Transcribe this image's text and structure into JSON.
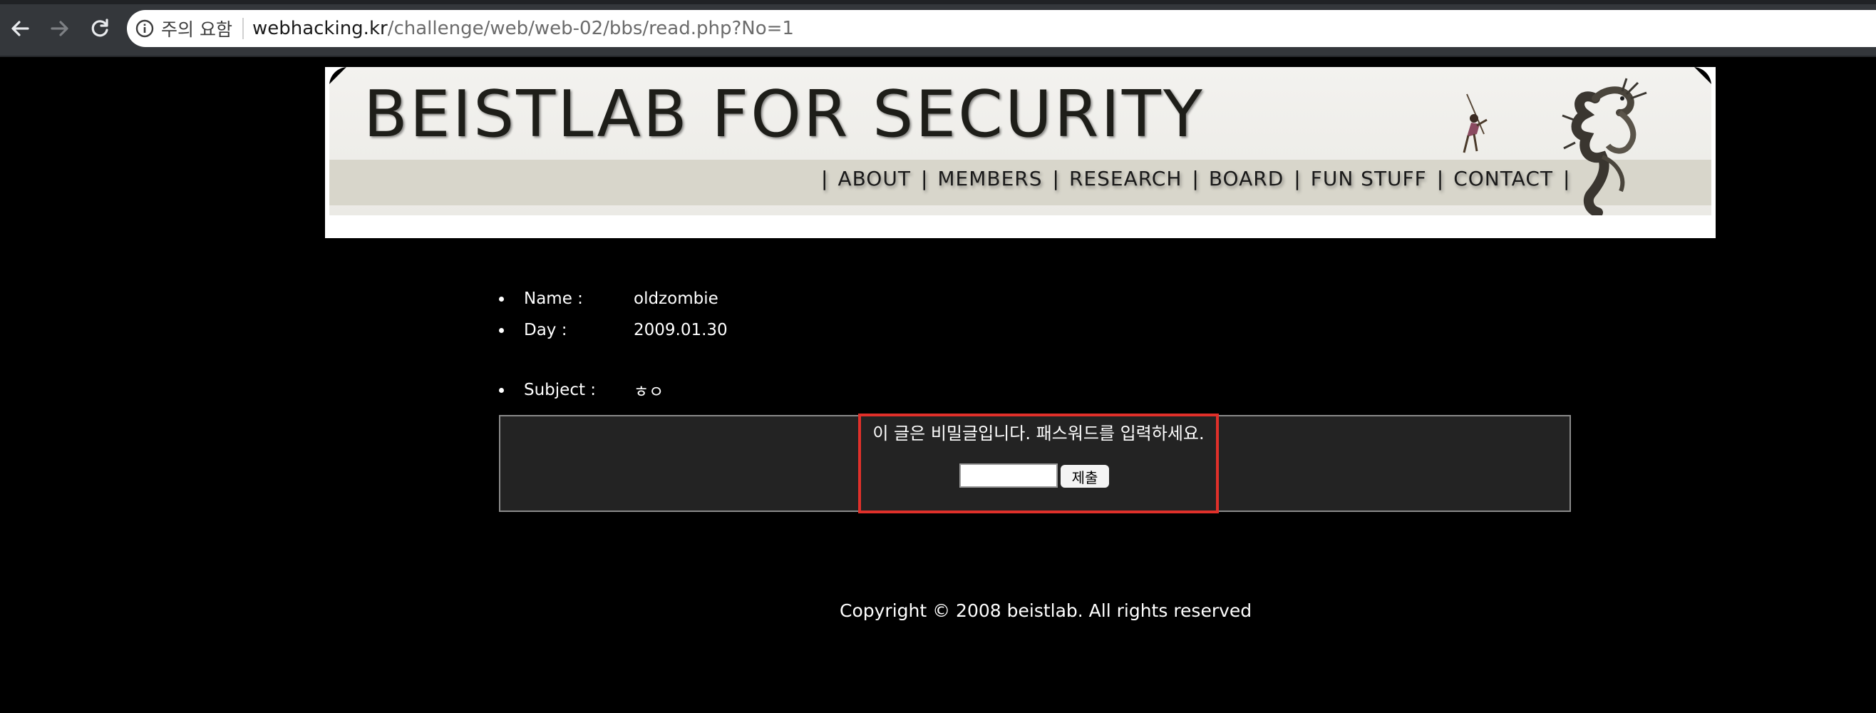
{
  "browser": {
    "security_label": "주의 요함",
    "url_host": "webhacking.kr",
    "url_path": "/challenge/web/web-02/bbs/read.php?No=1"
  },
  "banner": {
    "title": "BEISTLAB FOR SECURITY",
    "menu": [
      "ABOUT",
      "MEMBERS",
      "RESEARCH",
      "BOARD",
      "FUN STUFF",
      "CONTACT"
    ],
    "separator": "|"
  },
  "post": {
    "name_label": "Name :",
    "name_value": "oldzombie",
    "day_label": "Day :",
    "day_value": "2009.01.30",
    "subject_label": "Subject :",
    "subject_value": "ㅎㅇ",
    "secret_message": "이 글은 비밀글입니다. 패스워드를 입력하세요.",
    "password_value": "",
    "submit_label": "제출"
  },
  "footer": {
    "copyright": "Copyright © 2008 beistlab. All rights reserved"
  },
  "colors": {
    "page_background": "#000000",
    "highlight_border": "#e0302a",
    "post_box_background": "#232323"
  }
}
